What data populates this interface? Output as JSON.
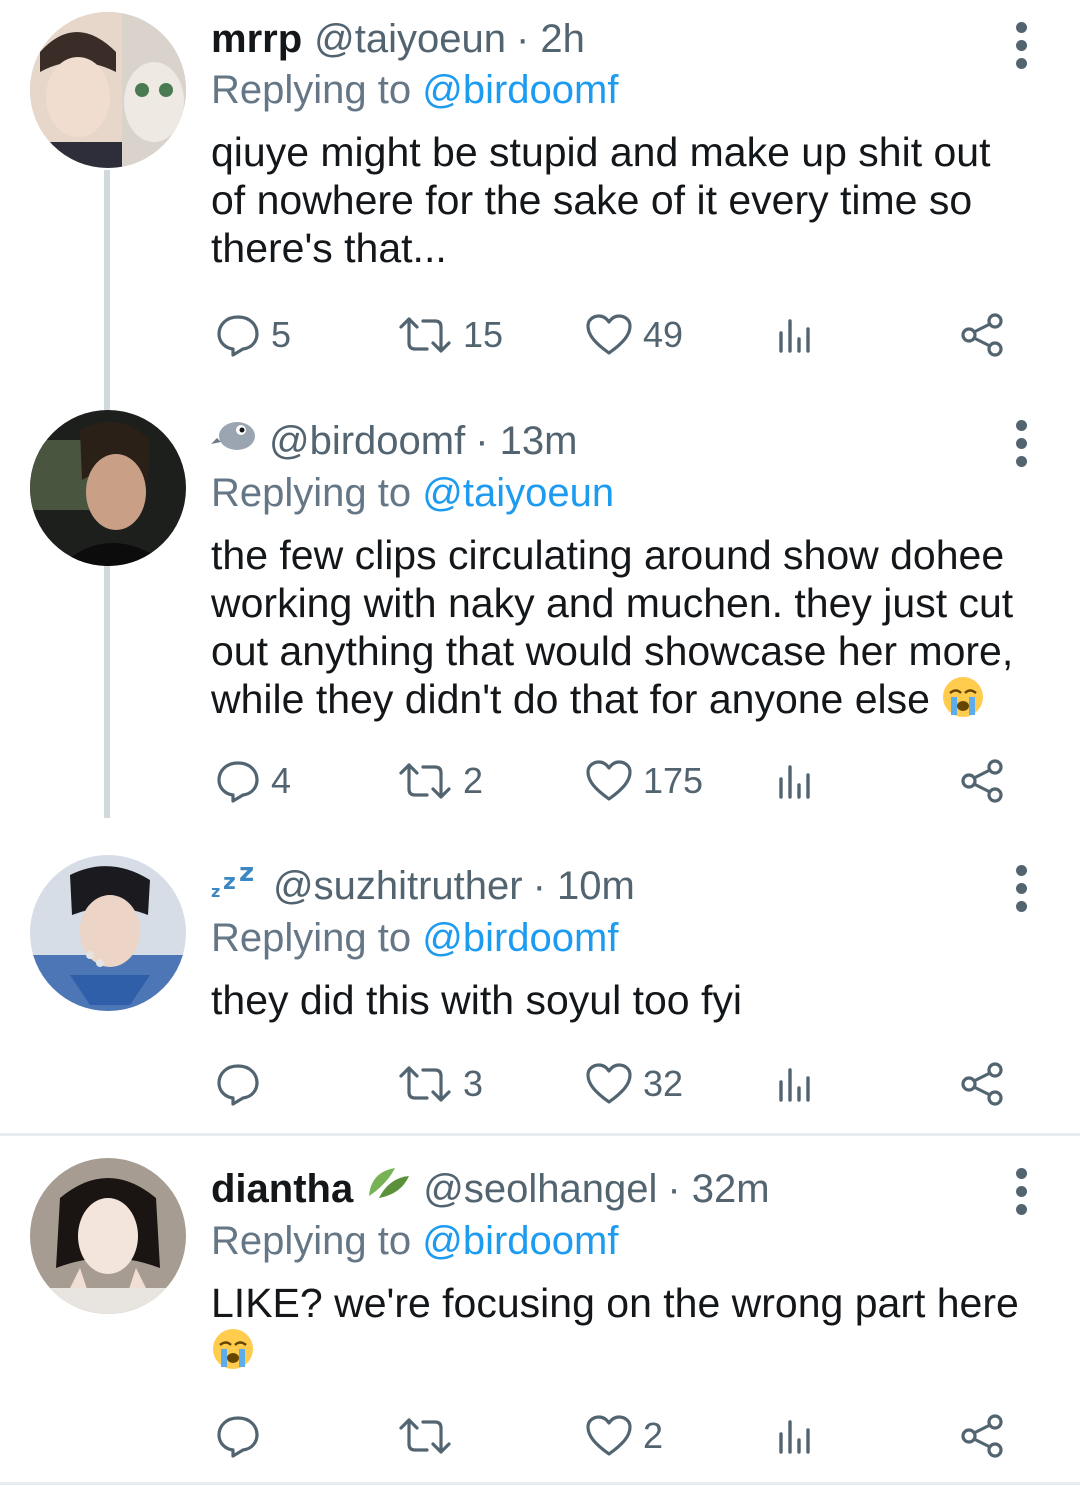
{
  "tweets": [
    {
      "name": "mrrp",
      "badge": "",
      "handle": "@taiyoeun",
      "time": "· 2h",
      "replying_prefix": "Replying to",
      "replying_to": "@birdoomf",
      "text": "qiuye might be stupid and make up shit out of nowhere for the sake of it every time so there's that...",
      "replies": "5",
      "retweets": "15",
      "likes": "49"
    },
    {
      "name": "",
      "badge": "bird-emoji",
      "handle": "@birdoomf",
      "time": "· 13m",
      "replying_prefix": "Replying to",
      "replying_to": "@taiyoeun",
      "text": "the few clips circulating around show dohee working with naky and muchen. they just cut out anything that would showcase her more, while they didn't do that for anyone else",
      "replies": "4",
      "retweets": "2",
      "likes": "175"
    },
    {
      "name": "",
      "badge": "zzz-emoji",
      "handle": "@suzhitruther",
      "time": "· 10m",
      "replying_prefix": "Replying to",
      "replying_to": "@birdoomf",
      "text": "they did this with soyul too fyi",
      "replies": "",
      "retweets": "3",
      "likes": "32"
    },
    {
      "name": "diantha",
      "badge": "leaf-emoji",
      "handle": "@seolhangel",
      "time": "· 32m",
      "replying_prefix": "Replying to",
      "replying_to": "@birdoomf",
      "text": "LIKE? we're focusing on the wrong part here",
      "replies": "",
      "retweets": "",
      "likes": "2"
    }
  ],
  "colors": {
    "link": "#1d9bf0",
    "muted": "#536471",
    "text": "#14171a",
    "thread": "#cfd9de"
  },
  "icons": [
    "reply-icon",
    "retweet-icon",
    "like-icon",
    "views-icon",
    "share-icon",
    "more-icon",
    "crying-face-emoji"
  ]
}
